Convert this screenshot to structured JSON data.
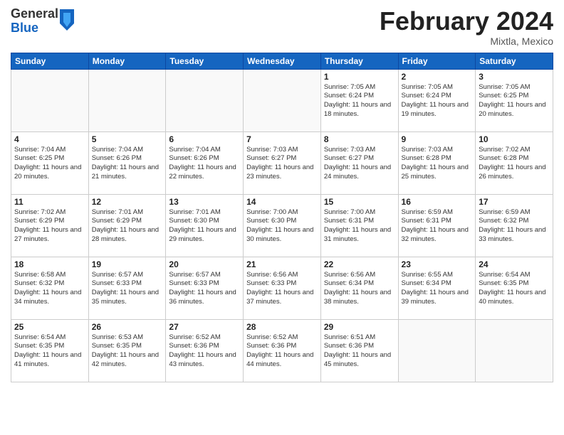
{
  "logo": {
    "general": "General",
    "blue": "Blue"
  },
  "header": {
    "month_year": "February 2024",
    "location": "Mixtla, Mexico"
  },
  "weekdays": [
    "Sunday",
    "Monday",
    "Tuesday",
    "Wednesday",
    "Thursday",
    "Friday",
    "Saturday"
  ],
  "weeks": [
    [
      {
        "day": "",
        "sunrise": "",
        "sunset": "",
        "daylight": ""
      },
      {
        "day": "",
        "sunrise": "",
        "sunset": "",
        "daylight": ""
      },
      {
        "day": "",
        "sunrise": "",
        "sunset": "",
        "daylight": ""
      },
      {
        "day": "",
        "sunrise": "",
        "sunset": "",
        "daylight": ""
      },
      {
        "day": "1",
        "sunrise": "Sunrise: 7:05 AM",
        "sunset": "Sunset: 6:24 PM",
        "daylight": "Daylight: 11 hours and 18 minutes."
      },
      {
        "day": "2",
        "sunrise": "Sunrise: 7:05 AM",
        "sunset": "Sunset: 6:24 PM",
        "daylight": "Daylight: 11 hours and 19 minutes."
      },
      {
        "day": "3",
        "sunrise": "Sunrise: 7:05 AM",
        "sunset": "Sunset: 6:25 PM",
        "daylight": "Daylight: 11 hours and 20 minutes."
      }
    ],
    [
      {
        "day": "4",
        "sunrise": "Sunrise: 7:04 AM",
        "sunset": "Sunset: 6:25 PM",
        "daylight": "Daylight: 11 hours and 20 minutes."
      },
      {
        "day": "5",
        "sunrise": "Sunrise: 7:04 AM",
        "sunset": "Sunset: 6:26 PM",
        "daylight": "Daylight: 11 hours and 21 minutes."
      },
      {
        "day": "6",
        "sunrise": "Sunrise: 7:04 AM",
        "sunset": "Sunset: 6:26 PM",
        "daylight": "Daylight: 11 hours and 22 minutes."
      },
      {
        "day": "7",
        "sunrise": "Sunrise: 7:03 AM",
        "sunset": "Sunset: 6:27 PM",
        "daylight": "Daylight: 11 hours and 23 minutes."
      },
      {
        "day": "8",
        "sunrise": "Sunrise: 7:03 AM",
        "sunset": "Sunset: 6:27 PM",
        "daylight": "Daylight: 11 hours and 24 minutes."
      },
      {
        "day": "9",
        "sunrise": "Sunrise: 7:03 AM",
        "sunset": "Sunset: 6:28 PM",
        "daylight": "Daylight: 11 hours and 25 minutes."
      },
      {
        "day": "10",
        "sunrise": "Sunrise: 7:02 AM",
        "sunset": "Sunset: 6:28 PM",
        "daylight": "Daylight: 11 hours and 26 minutes."
      }
    ],
    [
      {
        "day": "11",
        "sunrise": "Sunrise: 7:02 AM",
        "sunset": "Sunset: 6:29 PM",
        "daylight": "Daylight: 11 hours and 27 minutes."
      },
      {
        "day": "12",
        "sunrise": "Sunrise: 7:01 AM",
        "sunset": "Sunset: 6:29 PM",
        "daylight": "Daylight: 11 hours and 28 minutes."
      },
      {
        "day": "13",
        "sunrise": "Sunrise: 7:01 AM",
        "sunset": "Sunset: 6:30 PM",
        "daylight": "Daylight: 11 hours and 29 minutes."
      },
      {
        "day": "14",
        "sunrise": "Sunrise: 7:00 AM",
        "sunset": "Sunset: 6:30 PM",
        "daylight": "Daylight: 11 hours and 30 minutes."
      },
      {
        "day": "15",
        "sunrise": "Sunrise: 7:00 AM",
        "sunset": "Sunset: 6:31 PM",
        "daylight": "Daylight: 11 hours and 31 minutes."
      },
      {
        "day": "16",
        "sunrise": "Sunrise: 6:59 AM",
        "sunset": "Sunset: 6:31 PM",
        "daylight": "Daylight: 11 hours and 32 minutes."
      },
      {
        "day": "17",
        "sunrise": "Sunrise: 6:59 AM",
        "sunset": "Sunset: 6:32 PM",
        "daylight": "Daylight: 11 hours and 33 minutes."
      }
    ],
    [
      {
        "day": "18",
        "sunrise": "Sunrise: 6:58 AM",
        "sunset": "Sunset: 6:32 PM",
        "daylight": "Daylight: 11 hours and 34 minutes."
      },
      {
        "day": "19",
        "sunrise": "Sunrise: 6:57 AM",
        "sunset": "Sunset: 6:33 PM",
        "daylight": "Daylight: 11 hours and 35 minutes."
      },
      {
        "day": "20",
        "sunrise": "Sunrise: 6:57 AM",
        "sunset": "Sunset: 6:33 PM",
        "daylight": "Daylight: 11 hours and 36 minutes."
      },
      {
        "day": "21",
        "sunrise": "Sunrise: 6:56 AM",
        "sunset": "Sunset: 6:33 PM",
        "daylight": "Daylight: 11 hours and 37 minutes."
      },
      {
        "day": "22",
        "sunrise": "Sunrise: 6:56 AM",
        "sunset": "Sunset: 6:34 PM",
        "daylight": "Daylight: 11 hours and 38 minutes."
      },
      {
        "day": "23",
        "sunrise": "Sunrise: 6:55 AM",
        "sunset": "Sunset: 6:34 PM",
        "daylight": "Daylight: 11 hours and 39 minutes."
      },
      {
        "day": "24",
        "sunrise": "Sunrise: 6:54 AM",
        "sunset": "Sunset: 6:35 PM",
        "daylight": "Daylight: 11 hours and 40 minutes."
      }
    ],
    [
      {
        "day": "25",
        "sunrise": "Sunrise: 6:54 AM",
        "sunset": "Sunset: 6:35 PM",
        "daylight": "Daylight: 11 hours and 41 minutes."
      },
      {
        "day": "26",
        "sunrise": "Sunrise: 6:53 AM",
        "sunset": "Sunset: 6:35 PM",
        "daylight": "Daylight: 11 hours and 42 minutes."
      },
      {
        "day": "27",
        "sunrise": "Sunrise: 6:52 AM",
        "sunset": "Sunset: 6:36 PM",
        "daylight": "Daylight: 11 hours and 43 minutes."
      },
      {
        "day": "28",
        "sunrise": "Sunrise: 6:52 AM",
        "sunset": "Sunset: 6:36 PM",
        "daylight": "Daylight: 11 hours and 44 minutes."
      },
      {
        "day": "29",
        "sunrise": "Sunrise: 6:51 AM",
        "sunset": "Sunset: 6:36 PM",
        "daylight": "Daylight: 11 hours and 45 minutes."
      },
      {
        "day": "",
        "sunrise": "",
        "sunset": "",
        "daylight": ""
      },
      {
        "day": "",
        "sunrise": "",
        "sunset": "",
        "daylight": ""
      }
    ]
  ]
}
